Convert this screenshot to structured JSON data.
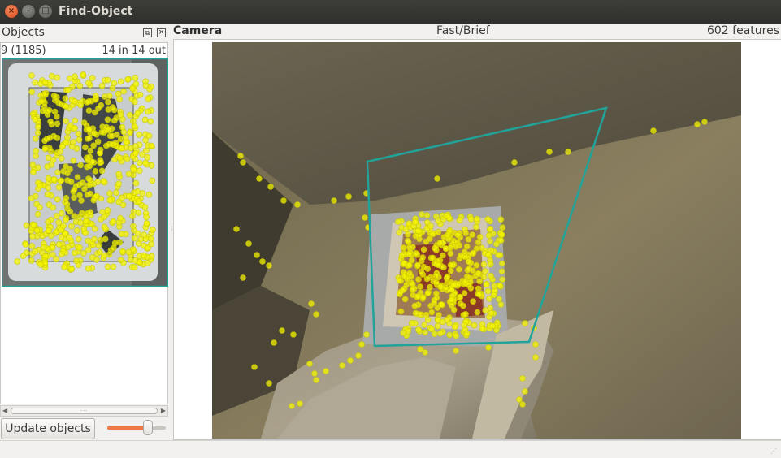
{
  "window": {
    "title": "Find-Object"
  },
  "objects_panel": {
    "title": "Objects",
    "object": {
      "id_label": "9 (1185)",
      "inout_label": "14 in 14 out"
    },
    "update_button": "Update objects",
    "threshold_slider": {
      "value_fraction": 0.69
    }
  },
  "camera_panel": {
    "title": "Camera",
    "detector": "Fast/Brief",
    "features": "602 features"
  },
  "colors": {
    "keypoint": "#f4f400",
    "homography": "#22a39a",
    "accent": "#f07746"
  },
  "icons": {
    "close": "close-icon",
    "minimize": "minimize-icon",
    "maximize": "maximize-icon",
    "dock_float": "float-icon",
    "dock_close": "dock-close-icon"
  }
}
